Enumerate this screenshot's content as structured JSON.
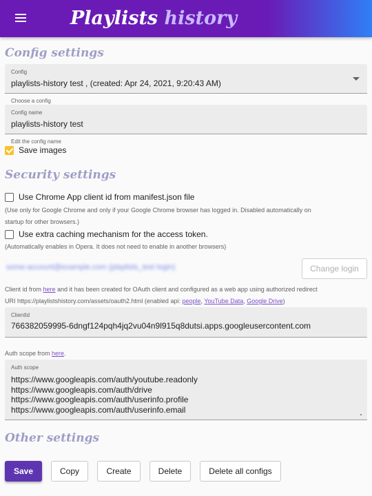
{
  "app": {
    "title_part1": "Playlists",
    "title_part2": "history"
  },
  "config_settings": {
    "heading": "Config settings",
    "config_select": {
      "label": "Config",
      "value": "playlists-history test , (created: Apr 24, 2021, 9:20:43 AM)",
      "hint": "Choose a config"
    },
    "config_name": {
      "label": "Config name",
      "value": "playlists-history test",
      "hint": "Edit the config name"
    },
    "save_images": {
      "label": "Save images",
      "checked": true
    }
  },
  "security_settings": {
    "heading": "Security settings",
    "chrome_client": {
      "label": "Use Chrome App client id from manifest.json file",
      "checked": false,
      "note_line1": "(Use only for Google Chrome and only if your Google Chrome browser has logged in. Disabled automatically on",
      "note_line2": "startup for other browsers.)"
    },
    "extra_caching": {
      "label": "Use extra caching mechanism for the access token.",
      "checked": false,
      "note": "(Automatically enables in Opera. It does not need to enable in another browsers)"
    },
    "account_blurred": "some-account@example.com (playlists_test login)",
    "change_login_label": "Change login",
    "client_description": {
      "prefix": "Client id from ",
      "here_link": "here",
      "middle": " and it has been created for OAuth client and configured as a web app using authorized redirect",
      "line2_prefix": "URI https://playlistshistory.com/assets/oauth2.html (enabled api: ",
      "people_link": "people",
      "sep1": ", ",
      "youtube_link": "YouTube Data",
      "sep2": ", ",
      "drive_link": "Google Drive",
      "suffix": ")"
    },
    "client_id": {
      "label": "ClientId",
      "value": "766382059995-6dngf124pqh4jq2vu04n9l915q8dutsi.apps.googleusercontent.com"
    },
    "auth_scope_from": {
      "prefix": "Auth scope from ",
      "here_link": "here",
      "suffix": "."
    },
    "auth_scope": {
      "label": "Auth scope",
      "lines": [
        "https://www.googleapis.com/auth/youtube.readonly",
        "https://www.googleapis.com/auth/drive",
        "https://www.googleapis.com/auth/userinfo.profile",
        "https://www.googleapis.com/auth/userinfo.email"
      ]
    }
  },
  "other_settings": {
    "heading": "Other settings"
  },
  "actions": {
    "save": "Save",
    "copy": "Copy",
    "create": "Create",
    "delete": "Delete",
    "delete_all": "Delete all configs"
  },
  "colors": {
    "appbar_start": "#6a1bb6",
    "appbar_end": "#2f7ff6",
    "primary": "#5e35b1",
    "checkbox_accent": "#fbc02d",
    "section_heading": "#9e9ec7",
    "link": "#7b4fc9"
  }
}
